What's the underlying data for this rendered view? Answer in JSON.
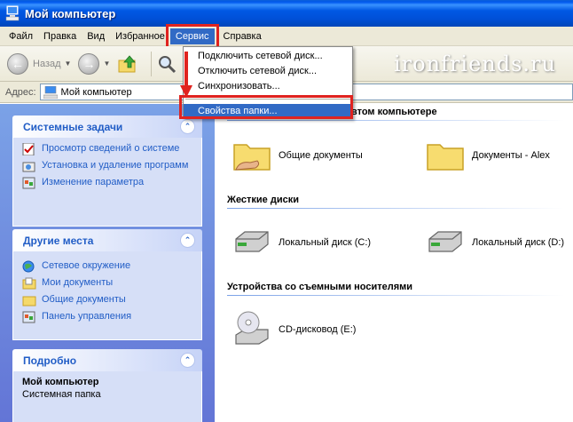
{
  "window": {
    "title": "Мой компьютер"
  },
  "menubar": {
    "items": [
      "Файл",
      "Правка",
      "Вид",
      "Избранное",
      "Сервис",
      "Справка"
    ]
  },
  "toolbar": {
    "back_label": "Назад"
  },
  "address": {
    "label": "Адрес:",
    "value": "Мой компьютер"
  },
  "dropdown": {
    "items": [
      "Подключить сетевой диск...",
      "Отключить сетевой диск...",
      "Синхронизовать...",
      "Свойства папки..."
    ]
  },
  "leftpane": {
    "system_tasks": {
      "title": "Системные задачи",
      "items": [
        "Просмотр сведений о системе",
        "Установка и удаление программ",
        "Изменение параметра"
      ]
    },
    "other_places": {
      "title": "Другие места",
      "items": [
        "Сетевое окружение",
        "Мои документы",
        "Общие документы",
        "Панель управления"
      ]
    },
    "details": {
      "title": "Подробно",
      "name": "Мой компьютер",
      "type": "Системная папка"
    }
  },
  "content": {
    "group1": {
      "title": "втом компьютере",
      "items": [
        "Общие документы",
        "Документы - Alex"
      ]
    },
    "group2": {
      "title": "Жесткие диски",
      "items": [
        "Локальный диск (C:)",
        "Локальный диск (D:)"
      ]
    },
    "group3": {
      "title": "Устройства со съемными носителями",
      "items": [
        "CD-дисковод (E:)"
      ]
    }
  },
  "watermark": "ironfriends.ru",
  "colors": {
    "xp_blue": "#0058e4",
    "menu_highlight": "#316ac5",
    "annotation_red": "#e0231f",
    "task_link": "#215dc6"
  }
}
